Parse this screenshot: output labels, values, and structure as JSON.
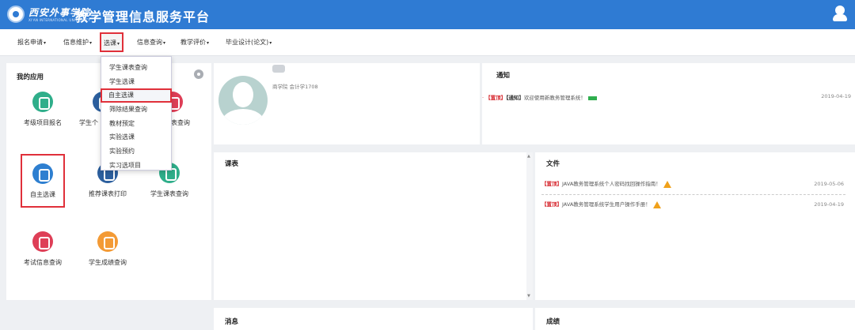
{
  "header": {
    "school_name": "西安外事学院",
    "school_name_en": "XI'AN INTERNATIONAL UNIVERSITY",
    "app_title": "教学管理信息服务平台"
  },
  "nav": {
    "items": [
      {
        "label": "报名申请"
      },
      {
        "label": "信息维护"
      },
      {
        "label": "选课"
      },
      {
        "label": "信息查询"
      },
      {
        "label": "教学评价"
      },
      {
        "label": "毕业设计(论文)"
      }
    ],
    "caret": "▾"
  },
  "dropdown": {
    "items": [
      {
        "label": "学生课表查询"
      },
      {
        "label": "学生选课"
      },
      {
        "label": "自主选课"
      },
      {
        "label": "筛除结果查询"
      },
      {
        "label": "教材预定"
      },
      {
        "label": "实验选课"
      },
      {
        "label": "实验预约"
      },
      {
        "label": "实习选项目"
      }
    ]
  },
  "my_apps": {
    "title": "我的应用",
    "apps": [
      {
        "label": "考级项目报名",
        "icon": "chat-icon"
      },
      {
        "label": "学生个",
        "icon": "person-icon"
      },
      {
        "label": "课表查询",
        "icon": "calendar-icon"
      },
      {
        "label": "自主选课",
        "icon": "ball-icon"
      },
      {
        "label": "推荐课表打印",
        "icon": "print-icon"
      },
      {
        "label": "学生课表查询",
        "icon": "phone-icon"
      },
      {
        "label": "考试信息查询",
        "icon": "exam-icon"
      },
      {
        "label": "学生成绩查询",
        "icon": "score-icon"
      }
    ]
  },
  "profile": {
    "info": "商学院 会计学1708"
  },
  "notice": {
    "title": "通知",
    "items": [
      {
        "tag1": "【置顶】",
        "tag2": "【通知】",
        "text": "欢迎使用新教务管理系统！",
        "date": "2019-04-19"
      }
    ]
  },
  "schedule": {
    "title": "课表"
  },
  "files": {
    "title": "文件",
    "items": [
      {
        "tag": "【置顶】",
        "text": "JAVA教务管理系统个人密码找回操作指南！",
        "date": "2019-05-06"
      },
      {
        "tag": "【置顶】",
        "text": "JAVA教务管理系统学生用户操作手册！",
        "date": "2019-04-19"
      }
    ]
  },
  "messages": {
    "title": "消息"
  },
  "grades": {
    "title": "成绩"
  },
  "colors": {
    "header_bg": "#2f7bd3",
    "highlight": "#e0303a",
    "tag_red": "#d7282f"
  }
}
